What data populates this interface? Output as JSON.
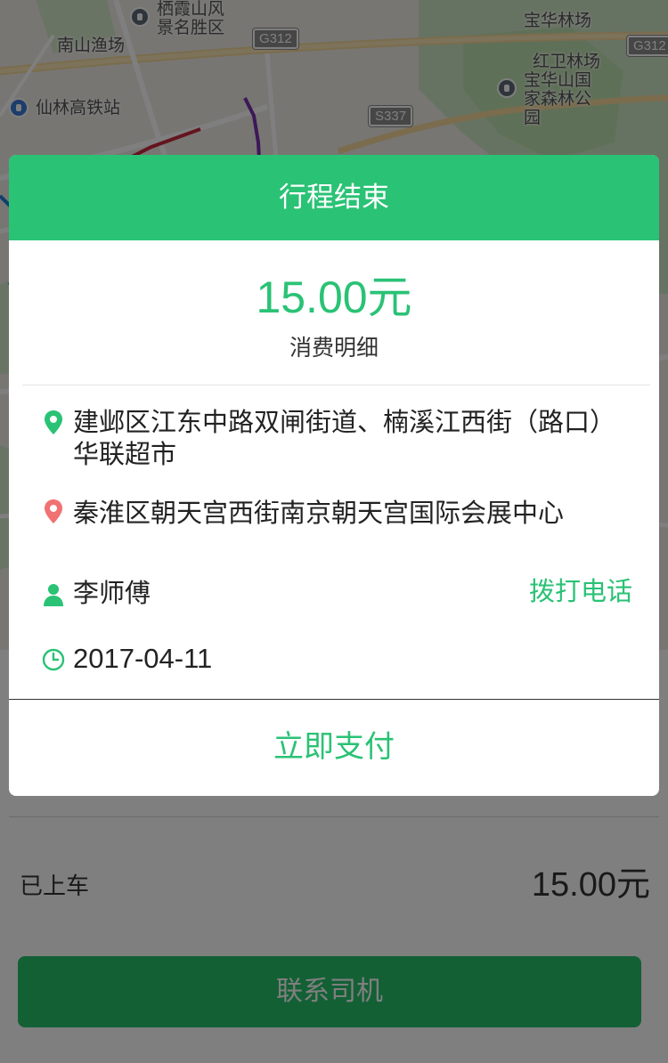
{
  "map": {
    "labels": {
      "scenic_area": "栖霞山风景名胜区",
      "nanshan_fishery": "南山渔场",
      "xianlin_station": "仙林高铁站",
      "baohua_forest": "宝华林场",
      "hongwei_forest": "红卫林场",
      "baohua_park": "宝华山国家森林公园"
    },
    "roads": {
      "g312_left": "G312",
      "g312_right": "G312",
      "s337": "S337"
    }
  },
  "modal": {
    "title": "行程结束",
    "fare": "15.00元",
    "fare_detail": "消费明细",
    "start_address": "建邺区江东中路双闸街道、楠溪江西街（路口）华联超市",
    "end_address": "秦淮区朝天宫西街南京朝天宫国际会展中心",
    "driver_name": "李师傅",
    "call_label": "拨打电话",
    "date": "2017-04-11",
    "pay_label": "立即支付"
  },
  "panel": {
    "status": "已上车",
    "price": "15.00元",
    "contact_label": "联系司机"
  },
  "colors": {
    "accent": "#2ac275",
    "start_pin": "#2ac275",
    "end_pin": "#f06b6b",
    "overlay": "rgba(0,0,0,0.5)"
  },
  "icons": {
    "start": "location-pin-icon",
    "end": "location-pin-icon",
    "driver": "person-icon",
    "date": "clock-icon"
  }
}
